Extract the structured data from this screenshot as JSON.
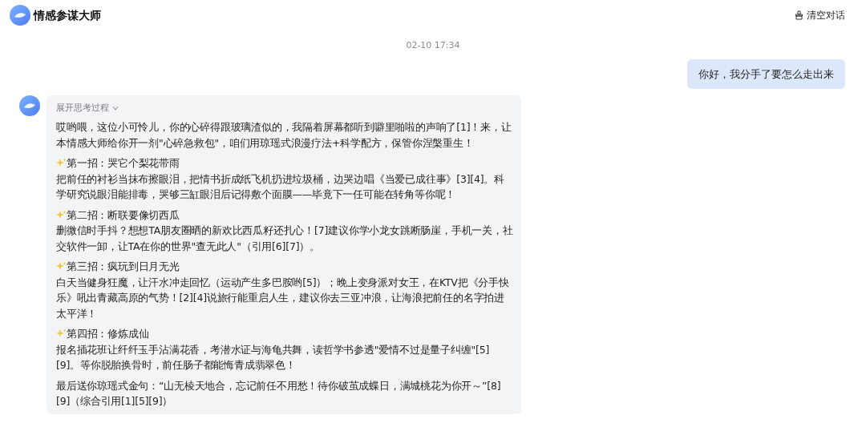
{
  "header": {
    "title": "情感参谋大师",
    "clear_button": "清空对话"
  },
  "timestamp": "02-10 17:34",
  "user_message": "你好，我分手了要怎么走出来",
  "reply": {
    "thinking_toggle": {
      "label": "展开思考过程",
      "expanded": false
    },
    "blocks": [
      {
        "kind": "text",
        "body": "哎哟喂，这位小可怜儿，你的心碎得跟玻璃渣似的，我隔着屏幕都听到噼里啪啦的声响了[1]！来，让本情感大师给你开一剂\"心碎急救包\"，咱们用琼瑶式浪漫疗法+科学配方，保管你涅槃重生！"
      },
      {
        "kind": "tip",
        "heading": "第一招：哭它个梨花带雨",
        "body": "把前任的衬衫当抹布擦眼泪，把情书折成纸飞机扔进垃圾桶，边哭边唱《当爱已成往事》[3][4]。科学研究说眼泪能排毒，哭够三缸眼泪后记得敷个面膜——毕竟下一任可能在转角等你呢！"
      },
      {
        "kind": "tip",
        "heading": "第二招：断联要像切西瓜",
        "body": "删微信时手抖？想想TA朋友圈晒的新欢比西瓜籽还扎心！[7]建议你学小龙女跳断肠崖，手机一关，社交软件一卸，让TA在你的世界\"查无此人\"（引用[6][7]）。"
      },
      {
        "kind": "tip",
        "heading": "第三招：疯玩到日月无光",
        "body": "白天当健身狂魔，让汗水冲走回忆（运动产生多巴胺哟[5]）；晚上变身派对女王，在KTV把《分手快乐》吼出青藏高原的气势！[2][4]说旅行能重启人生，建议你去三亚冲浪，让海浪把前任的名字拍进太平洋！"
      },
      {
        "kind": "tip",
        "heading": "第四招：修炼成仙",
        "body": "报名插花班让纤纤玉手沾满花香，考潜水证与海龟共舞，读哲学书参透\"爱情不过是量子纠缠\"[5][9]。等你脱胎换骨时，前任肠子都能悔青成翡翠色！"
      },
      {
        "kind": "text",
        "body": "最后送你琼瑶式金句：“山无棱天地合，忘记前任不用愁！待你破茧成蝶日，满城桃花为你开～”[8][9]（综合引用[1][5][9]）"
      }
    ]
  }
}
